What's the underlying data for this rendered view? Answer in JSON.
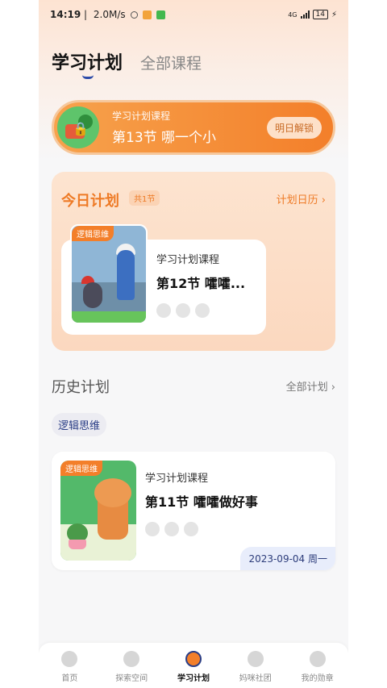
{
  "status": {
    "time": "14:19",
    "net": "2.0M/s",
    "signal": "4G",
    "battery": "14"
  },
  "tabs": {
    "active": "学习计划",
    "other": "全部课程"
  },
  "banner": {
    "sub": "学习计划课程",
    "title": "第13节  哪一个小",
    "button": "明日解锁"
  },
  "today": {
    "title": "今日计划",
    "count": "共1节",
    "calendar": "计划日历",
    "card": {
      "tag": "逻辑思维",
      "sub": "学习计划课程",
      "title": "第12节  嚯嚯..."
    }
  },
  "history": {
    "title": "历史计划",
    "all": "全部计划",
    "chip": "逻辑思维",
    "card": {
      "tag": "逻辑思维",
      "sub": "学习计划课程",
      "title": "第11节  嚯嚯做好事",
      "date": "2023-09-04 周一"
    }
  },
  "nav": [
    {
      "label": "首页"
    },
    {
      "label": "探索空间"
    },
    {
      "label": "学习计划"
    },
    {
      "label": "妈咪社团"
    },
    {
      "label": "我的勋章"
    }
  ],
  "colors": {
    "accent": "#f37f2a",
    "navy": "#2b3e86"
  }
}
